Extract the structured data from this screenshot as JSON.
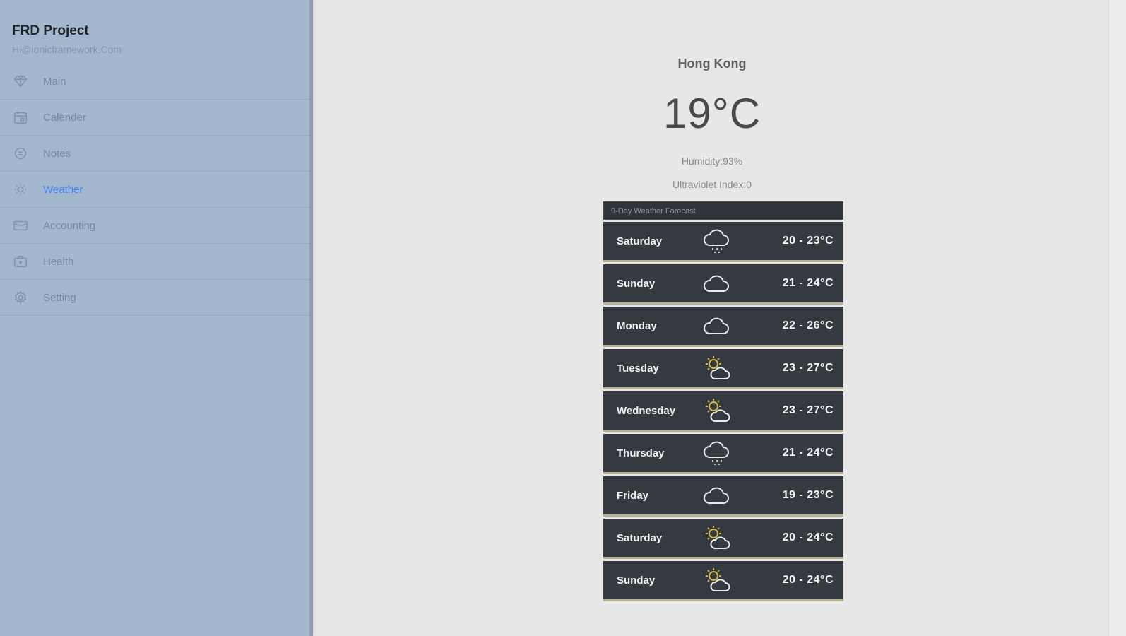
{
  "sidebar": {
    "title": "FRD Project",
    "email": "Hi@ionicframework.Com",
    "items": [
      {
        "label": "Main",
        "icon": "diamond-icon"
      },
      {
        "label": "Calender",
        "icon": "calendar-icon"
      },
      {
        "label": "Notes",
        "icon": "notes-icon"
      },
      {
        "label": "Weather",
        "icon": "sun-icon"
      },
      {
        "label": "Accounting",
        "icon": "wallet-icon"
      },
      {
        "label": "Health",
        "icon": "medkit-icon"
      },
      {
        "label": "Setting",
        "icon": "gear-icon"
      }
    ],
    "active_index": 3
  },
  "weather": {
    "city": "Hong Kong",
    "temperature": "19°C",
    "humidity": "Humidity:93%",
    "uv": "Ultraviolet Index:0",
    "forecast_title": "9-Day Weather Forecast",
    "forecast": [
      {
        "day": "Saturday",
        "range": "20 - 23°C",
        "icon": "rain-cloud-icon"
      },
      {
        "day": "Sunday",
        "range": "21 - 24°C",
        "icon": "cloud-icon"
      },
      {
        "day": "Monday",
        "range": "22 - 26°C",
        "icon": "cloud-icon"
      },
      {
        "day": "Tuesday",
        "range": "23 - 27°C",
        "icon": "sun-cloud-icon"
      },
      {
        "day": "Wednesday",
        "range": "23 - 27°C",
        "icon": "sun-cloud-icon"
      },
      {
        "day": "Thursday",
        "range": "21 - 24°C",
        "icon": "rain-cloud-icon"
      },
      {
        "day": "Friday",
        "range": "19 - 23°C",
        "icon": "cloud-icon"
      },
      {
        "day": "Saturday",
        "range": "20 - 24°C",
        "icon": "sun-cloud-icon"
      },
      {
        "day": "Sunday",
        "range": "20 - 24°C",
        "icon": "sun-cloud-icon"
      }
    ]
  },
  "colors": {
    "sidebar_bg": "#a3b8cf",
    "active_text": "#3e86f4",
    "forecast_row": "#343a40",
    "sun_accent": "#d1b94a"
  }
}
